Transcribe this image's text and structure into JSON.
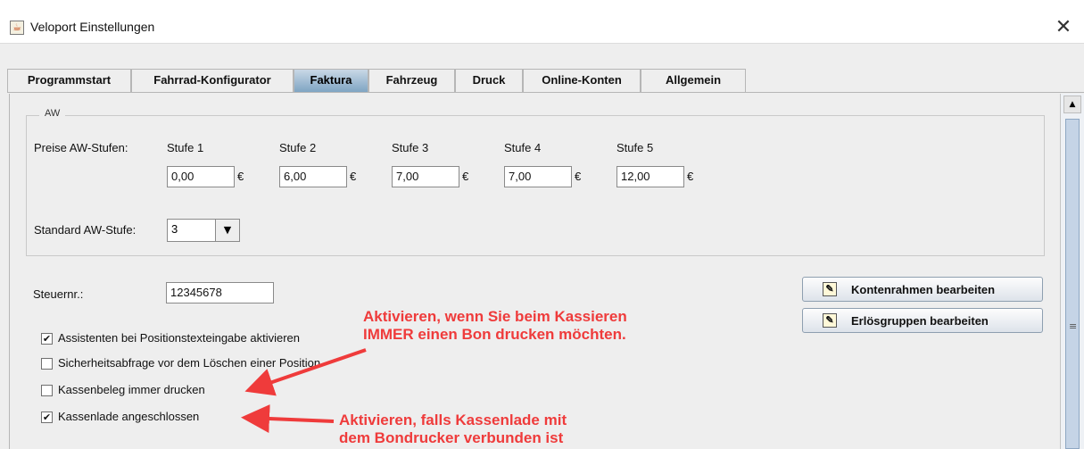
{
  "window": {
    "title": "Veloport Einstellungen",
    "close_glyph": "✕"
  },
  "tabs": [
    {
      "label": "Programmstart"
    },
    {
      "label": "Fahrrad-Konfigurator"
    },
    {
      "label": "Faktura"
    },
    {
      "label": "Fahrzeug"
    },
    {
      "label": "Druck"
    },
    {
      "label": "Online-Konten"
    },
    {
      "label": "Allgemein"
    }
  ],
  "active_tab": "Faktura",
  "aw": {
    "legend": "AW",
    "prices_label": "Preise AW-Stufen:",
    "levels": [
      {
        "label": "Stufe 1",
        "value": "0,00",
        "currency": "€"
      },
      {
        "label": "Stufe 2",
        "value": "6,00",
        "currency": "€"
      },
      {
        "label": "Stufe 3",
        "value": "7,00",
        "currency": "€"
      },
      {
        "label": "Stufe 4",
        "value": "7,00",
        "currency": "€"
      },
      {
        "label": "Stufe 5",
        "value": "12,00",
        "currency": "€"
      }
    ],
    "standard_label": "Standard AW-Stufe:",
    "standard_value": "3"
  },
  "tax": {
    "label": "Steuernr.:",
    "value": "12345678"
  },
  "checkboxes": [
    {
      "label": "Assistenten bei Positionstexteingabe aktivieren",
      "checked": true
    },
    {
      "label": "Sicherheitsabfrage vor dem Löschen einer Position",
      "checked": false
    },
    {
      "label": "Kassenbeleg immer drucken",
      "checked": false
    },
    {
      "label": "Kassenlade angeschlossen",
      "checked": true
    }
  ],
  "buttons": {
    "kontenrahmen": "Kontenrahmen bearbeiten",
    "erloesgruppen": "Erlösgruppen bearbeiten"
  },
  "annotations": {
    "note1_line1": "Aktivieren, wenn Sie beim Kassieren",
    "note1_line2": "IMMER einen Bon drucken möchten.",
    "note2_line1": "Aktivieren, falls Kassenlade mit",
    "note2_line2": "dem Bondrucker verbunden ist",
    "color": "#ef3b3b"
  },
  "colors": {
    "active_tab_top": "#c9d8e6",
    "active_tab_bottom": "#7fa5c3",
    "panel_bg": "#eeeeee"
  }
}
